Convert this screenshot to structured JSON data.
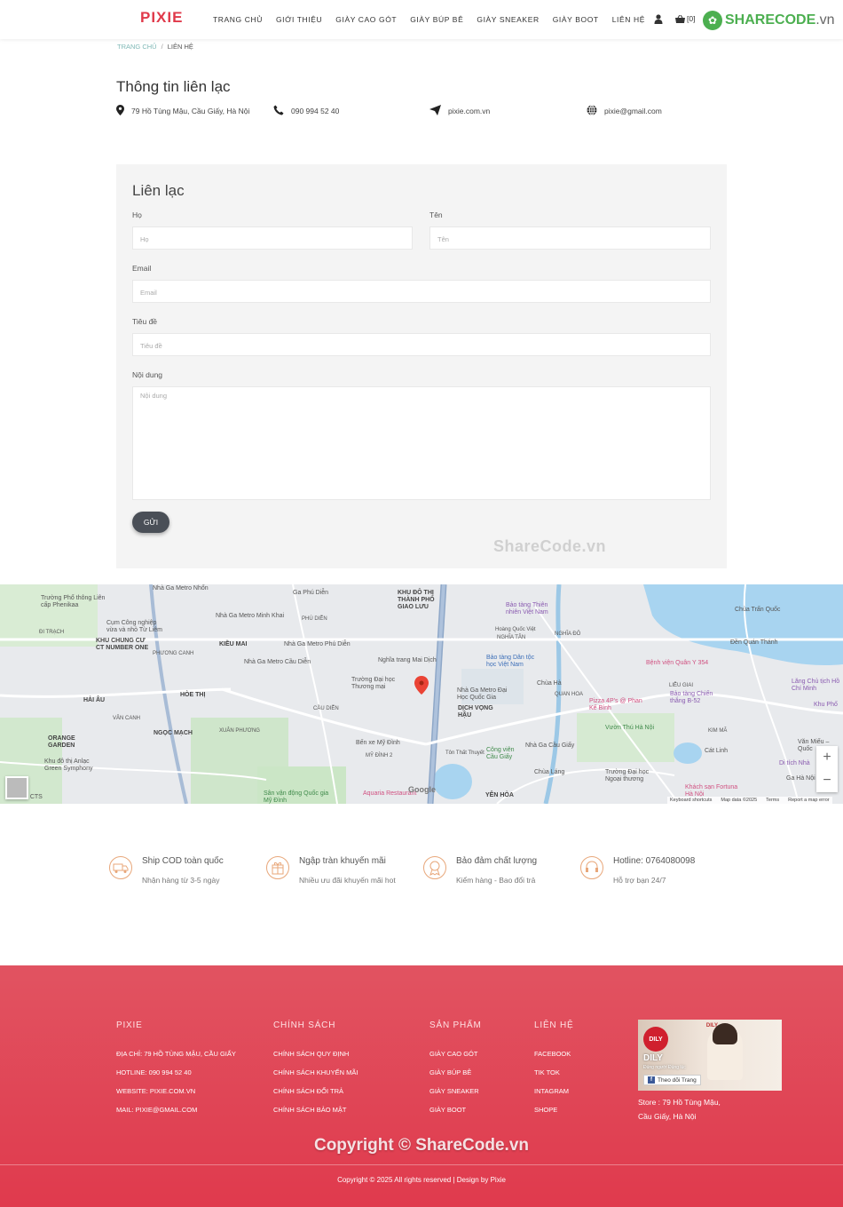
{
  "header": {
    "logo": "PIXIE",
    "nav": [
      "TRANG CHỦ",
      "GIỚI THIỆU",
      "GIÀY CAO GÓT",
      "GIÀY BÚP BÊ",
      "GIÀY SNEAKER",
      "GIÀY BOOT",
      "LIÊN HỆ"
    ],
    "cart_count": "[0]",
    "watermark_logo": "SHARECODE",
    "watermark_logo_suffix": ".vn"
  },
  "breadcrumb": {
    "home": "TRANG CHỦ",
    "separator": "/",
    "current": "LIÊN HỆ"
  },
  "contact": {
    "title": "Thông tin liên lạc",
    "address": "79 Hồ Tùng Mậu, Cầu Giấy, Hà Nội",
    "phone": "090 994 52 40",
    "website": "pixie.com.vn",
    "email": "pixie@gmail.com"
  },
  "form": {
    "title": "Liên lạc",
    "last_name_label": "Họ",
    "last_name_placeholder": "Họ",
    "first_name_label": "Tên",
    "first_name_placeholder": "Tên",
    "email_label": "Email",
    "email_placeholder": "Email",
    "subject_label": "Tiêu đề",
    "subject_placeholder": "Tiêu đề",
    "message_label": "Nội dung",
    "message_placeholder": "Nội dung",
    "submit": "GỬI",
    "watermark": "ShareCode.vn"
  },
  "map": {
    "labels": [
      "Nhà Ga Metro Nhổn",
      "Ga Phú Diễn",
      "KHU ĐÔ THỊ THÀNH PHỐ GIAO LƯU",
      "Chùa Trấn Quốc",
      "Trường Phổ thông Liên cấp Phenikaa",
      "Nhà Ga Metro Minh Khai",
      "PHÚ DIỄN",
      "Hoàng Quốc Việt",
      "Bảo tàng Thiên nhiên Việt Nam",
      "ĐI TRẠCH",
      "Cụm Công nghiệp vừa và nhỏ Từ Liêm",
      "KIỀU MAI",
      "Nhà Ga Metro Phú Diễn",
      "NGHĨA TÂN",
      "NGHĨA ĐÔ",
      "Đền Quán Thánh",
      "KHU CHUNG CƯ CT NUMBER ONE",
      "PHƯƠNG CANH",
      "Nhà Ga Metro Cầu Diễn",
      "Nghĩa trang Mai Dịch",
      "Bảo tàng Dân tộc học Việt Nam",
      "Bệnh viện Quân Y 354",
      "LIỄU GIAI",
      "Lăng Chủ tịch Hồ Chí Minh",
      "HÒE THỊ",
      "HẢI ÂU",
      "CẦU DIỄN",
      "Trường Đại học Thương mại",
      "Nhà Ga Metro Đại Học Quốc Gia",
      "Chùa Hà",
      "QUAN HOA",
      "Bảo tàng Chiến thắng B-52",
      "Khu Phố",
      "VÂN CANH",
      "NGỌC MẠCH",
      "XUÂN PHƯƠNG",
      "DỊCH VỌNG HẬU",
      "Nhà Ga Cầu Giấy",
      "Pizza 4P's @ Phan Kế Bính",
      "Vườn Thú Hà Nội",
      "KIM MÃ",
      "ORANGE GARDEN",
      "Bến xe Mỹ Đình",
      "MỸ ĐÌNH 2",
      "Tôn Thất Thuyết",
      "Công viên Cầu Giấy",
      "Cát Linh",
      "Văn Miếu – Quốc",
      "Khu đô thị Anlạc Green Symphony",
      "Sân vận động Quốc gia Mỹ Đình",
      "Aquaria Restaurant",
      "YÊN HÒA",
      "Chùa Láng",
      "Trường Đại học Ngoại thương",
      "Khách sạn Fortuna Hà Nội",
      "Di tích Nhà",
      "Ga Hà Nội",
      "KĐT CTS"
    ],
    "road_codes": [
      "DT70A",
      "QL32",
      "CT37",
      "DT423B",
      "DT70A",
      "CT37",
      "DT70A"
    ],
    "footer": [
      "Keyboard shortcuts",
      "Map data ©2025",
      "Terms",
      "Report a map error"
    ],
    "google": "Google"
  },
  "features": [
    {
      "icon": "truck-icon",
      "title": "Ship COD toàn quốc",
      "sub": "Nhận hàng từ 3-5 ngày"
    },
    {
      "icon": "gift-icon",
      "title": "Ngập tràn khuyến mãi",
      "sub": "Nhiều ưu đãi khuyến mãi hot"
    },
    {
      "icon": "medal-icon",
      "title": "Bảo đảm chất lượng",
      "sub": "Kiểm hàng - Bao đổi trả"
    },
    {
      "icon": "headset-icon",
      "title": "Hotline: 0764080098",
      "sub": "Hỗ trợ bạn 24/7"
    }
  ],
  "footer": {
    "col1": {
      "heading": "PIXIE",
      "items": [
        "ĐỊA CHỈ: 79 HỒ TÙNG MẬU, CẦU GIẤY",
        "HOTLINE: 090 994 52 40",
        "WEBSITE: PIXIE.COM.VN",
        "MAIL: PIXIE@GMAIL.COM"
      ]
    },
    "col2": {
      "heading": "CHÍNH SÁCH",
      "items": [
        "CHÍNH SÁCH QUY ĐỊNH",
        "CHÍNH SÁCH KHUYẾN MÃI",
        "CHÍNH SÁCH ĐỔI TRẢ",
        "CHÍNH SÁCH BẢO MẬT"
      ]
    },
    "col3": {
      "heading": "SẢN PHẨM",
      "items": [
        "GIÀY CAO GÓT",
        "GIÀY BÚP BÊ",
        "GIÀY SNEAKER",
        "GIÀY BOOT"
      ]
    },
    "col4": {
      "heading": "LIÊN HỆ",
      "items": [
        "FACEBOOK",
        "TIK TOK",
        "INTAGRAM",
        "SHOPE"
      ]
    },
    "fb": {
      "logo": "DILY",
      "brand": "DILY",
      "tagline": "Đúng người Đúng lúc",
      "follow": "Theo dõi Trang",
      "top": "DILY"
    },
    "store": "Store : 79 Hồ Tùng Mậu, Cầu Giấy, Hà Nội",
    "watermark": "Copyright © ShareCode.vn",
    "copyright": "Copyright © 2025 All rights reserved | Design by Pixie"
  },
  "colors": {
    "brand": "#e0394a",
    "footer_top": "#e15361",
    "footer_bottom": "#e03a4d",
    "form_bg": "#f4f4f4",
    "button": "#4a4f57"
  }
}
